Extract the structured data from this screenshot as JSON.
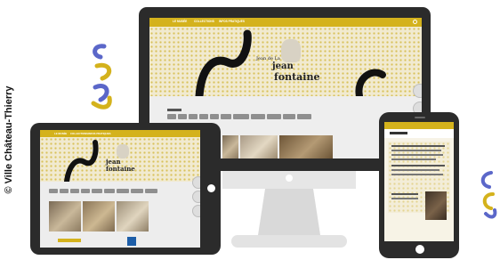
{
  "credit": "© Ville Château-Thierry",
  "site": {
    "logo_line1": "jean",
    "logo_line2": "fontaine",
    "logo_prefix": "Jean de La",
    "nav": [
      "LE MUSÉE",
      "COLLECTIONS",
      "INFOS PRATIQUES"
    ],
    "filter_count": 11
  },
  "colors": {
    "brand_yellow": "#d4b21c",
    "accent_blue": "#5b67c9",
    "device_black": "#2b2b2b"
  }
}
